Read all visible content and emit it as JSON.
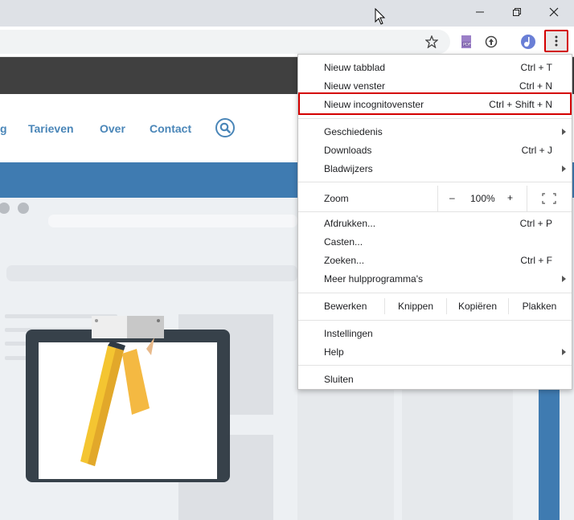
{
  "browser": {
    "menu": {
      "items": [
        {
          "label": "Nieuw tabblad",
          "shortcut": "Ctrl + T"
        },
        {
          "label": "Nieuw venster",
          "shortcut": "Ctrl + N"
        },
        {
          "label": "Nieuw incognitovenster",
          "shortcut": "Ctrl + Shift + N"
        },
        {
          "label": "Geschiedenis",
          "shortcut": ""
        },
        {
          "label": "Downloads",
          "shortcut": "Ctrl + J"
        },
        {
          "label": "Bladwijzers",
          "shortcut": ""
        },
        {
          "label": "Afdrukken...",
          "shortcut": "Ctrl + P"
        },
        {
          "label": "Casten...",
          "shortcut": ""
        },
        {
          "label": "Zoeken...",
          "shortcut": "Ctrl + F"
        },
        {
          "label": "Meer hulpprogramma's",
          "shortcut": ""
        },
        {
          "label": "Instellingen",
          "shortcut": ""
        },
        {
          "label": "Help",
          "shortcut": ""
        },
        {
          "label": "Sluiten",
          "shortcut": ""
        }
      ],
      "zoom": {
        "label": "Zoom",
        "minus": "–",
        "value": "100%",
        "plus": "+"
      },
      "edit": {
        "label": "Bewerken",
        "cut": "Knippen",
        "copy": "Kopiëren",
        "paste": "Plakken"
      }
    },
    "icons": [
      "star-icon",
      "pdf-extension-icon",
      "extension-icon",
      "profile-icon",
      "more-menu-icon",
      "minimize-icon",
      "maximize-icon",
      "close-icon",
      "fullscreen-icon",
      "search-icon"
    ]
  },
  "page": {
    "nav": {
      "partial": "g",
      "tarieven": "Tarieven",
      "over": "Over",
      "contact": "Contact"
    }
  },
  "colors": {
    "accent": "#4a86b8",
    "highlight": "#d40000",
    "band_dark": "#404040",
    "band_blue": "#3f7bb1"
  }
}
